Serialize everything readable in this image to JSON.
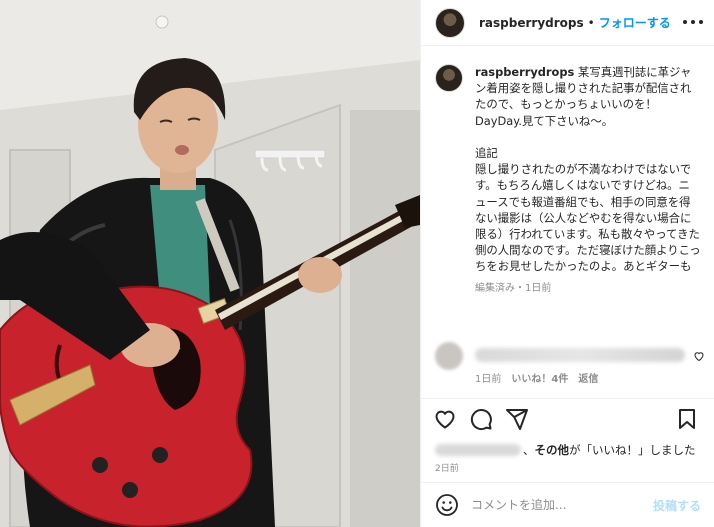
{
  "post": {
    "username": "raspberrydrops",
    "separator": "•",
    "follow_label": "フォローする",
    "more_icon": "more-horizontal-icon"
  },
  "caption": {
    "username": "raspberrydrops",
    "text": " 某写真週刊誌に革ジャン着用姿を隠し撮りされた記事が配信されたので、もっとかっちょいいのを！\nDayDay.見て下さいね〜。\n\n追記\n隠し撮りされたのが不満なわけではないです。もちろん嬉しくはないですけどね。ニュースでも報道番組でも、相手の同意を得ない撮影は（公人などやむを得ない場合に限る）行われています。私も散々やってきた側の人間なのです。ただ寝ぼけた顔よりこっちをお見せしたかったのよ。あとギターも",
    "edited": "編集済み",
    "meta_sep": "・",
    "time": "1日前"
  },
  "comment": {
    "time": "1日前",
    "likes": "いいね！4件",
    "reply": "返信"
  },
  "actions": {
    "like_icon": "heart-icon",
    "comment_icon": "comment-icon",
    "share_icon": "send-icon",
    "save_icon": "bookmark-icon"
  },
  "likes": {
    "comma": "、",
    "others": "その他",
    "suffix": "が「いいね！」しました"
  },
  "post_age": "2日前",
  "add_comment": {
    "placeholder": "コメントを追加...",
    "post_label": "投稿する",
    "emoji_icon": "emoji-icon"
  },
  "colors": {
    "link": "#0095f6",
    "post_disabled": "#b2dffc",
    "guitar": "#c8232c"
  }
}
